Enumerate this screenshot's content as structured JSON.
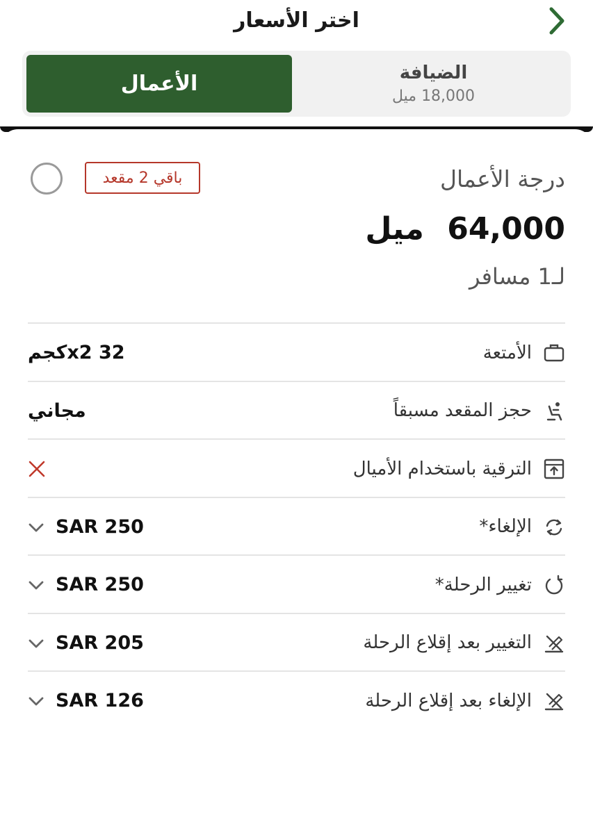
{
  "header": {
    "title": "اختر الأسعار"
  },
  "tabs": [
    {
      "label": "الأعمال",
      "selected": true
    },
    {
      "label": "الضيافة",
      "sub_value": "18,000",
      "sub_unit": "ميل",
      "selected": false
    }
  ],
  "fare_card": {
    "class_name": "درجة الأعمال",
    "badge": "باقي 2 مقعد",
    "price_value": "64,000",
    "price_unit": "ميل",
    "passengers": "لـ1 مسافر"
  },
  "features": [
    {
      "label": "الأمتعة",
      "icon": "luggage-icon",
      "value": "x2 32كجم",
      "expandable": false
    },
    {
      "label": "حجز المقعد مسبقاً",
      "icon": "seat-icon",
      "value": "مجاني",
      "expandable": false
    },
    {
      "label": "الترقية باستخدام الأميال",
      "icon": "upgrade-icon",
      "value": "",
      "value_icon": "cross-icon",
      "expandable": false
    },
    {
      "label": "الإلغاء*",
      "icon": "refund-icon",
      "value": "SAR 250",
      "expandable": true
    },
    {
      "label": "تغيير الرحلة*",
      "icon": "change-icon",
      "value": "SAR 250",
      "expandable": true
    },
    {
      "label": "التغيير بعد إقلاع الرحلة",
      "icon": "departed-change-icon",
      "value": "SAR 205",
      "expandable": true
    },
    {
      "label": "الإلغاء بعد إقلاع الرحلة",
      "icon": "departed-cancel-icon",
      "value": "SAR 126",
      "expandable": true
    }
  ],
  "colors": {
    "brand_green": "#2e5e2e",
    "badge_red": "#b5372a",
    "cross_red": "#c0392b"
  }
}
